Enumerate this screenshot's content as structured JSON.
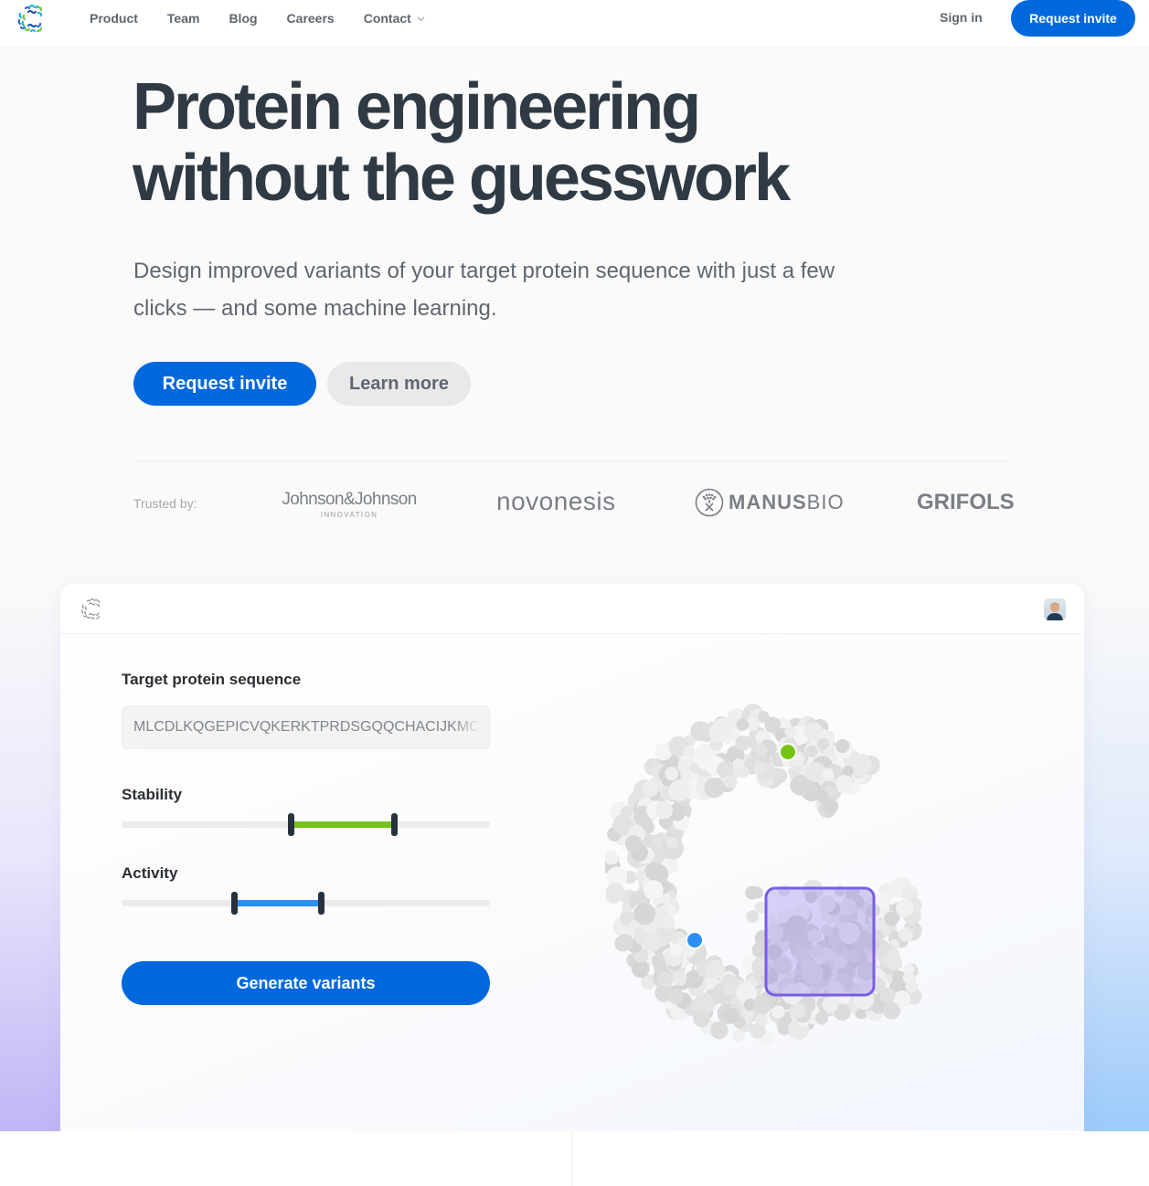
{
  "nav": {
    "logo": "c-molecule-logo",
    "links": [
      {
        "label": "Product"
      },
      {
        "label": "Team"
      },
      {
        "label": "Blog"
      },
      {
        "label": "Careers"
      },
      {
        "label": "Contact",
        "has_dropdown": true
      }
    ],
    "sign_in": "Sign in",
    "cta": "Request invite"
  },
  "hero": {
    "title_line1": "Protein engineering",
    "title_line2": "without the guesswork",
    "subtitle": "Design improved variants of your target protein sequence with just a few clicks — and some machine learning.",
    "primary_button": "Request invite",
    "secondary_button": "Learn more"
  },
  "trusted": {
    "label": "Trusted by:",
    "brands": [
      {
        "name": "Johnson&Johnson",
        "sub": "INNOVATION"
      },
      {
        "name": "novonesis"
      },
      {
        "name_bold": "MANUS",
        "name_light": "BIO"
      },
      {
        "name": "GRIFOLS"
      }
    ]
  },
  "demo": {
    "sequence_label": "Target protein sequence",
    "sequence_value": "MLCDLKQGEPICVQKERKTPRDSGQQCHACIJKMC",
    "sliders": [
      {
        "label": "Stability",
        "low": 0.46,
        "high": 0.74,
        "color": "#74c416"
      },
      {
        "label": "Activity",
        "low": 0.305,
        "high": 0.54,
        "color": "#2b8ff5"
      }
    ],
    "generate_button": "Generate variants",
    "markers": {
      "green": "#74c416",
      "blue": "#2b8ff5",
      "selection": "#7a5de6"
    }
  },
  "colors": {
    "primary": "#0068dd",
    "heading": "#2f3a44",
    "muted": "#5f6670"
  }
}
